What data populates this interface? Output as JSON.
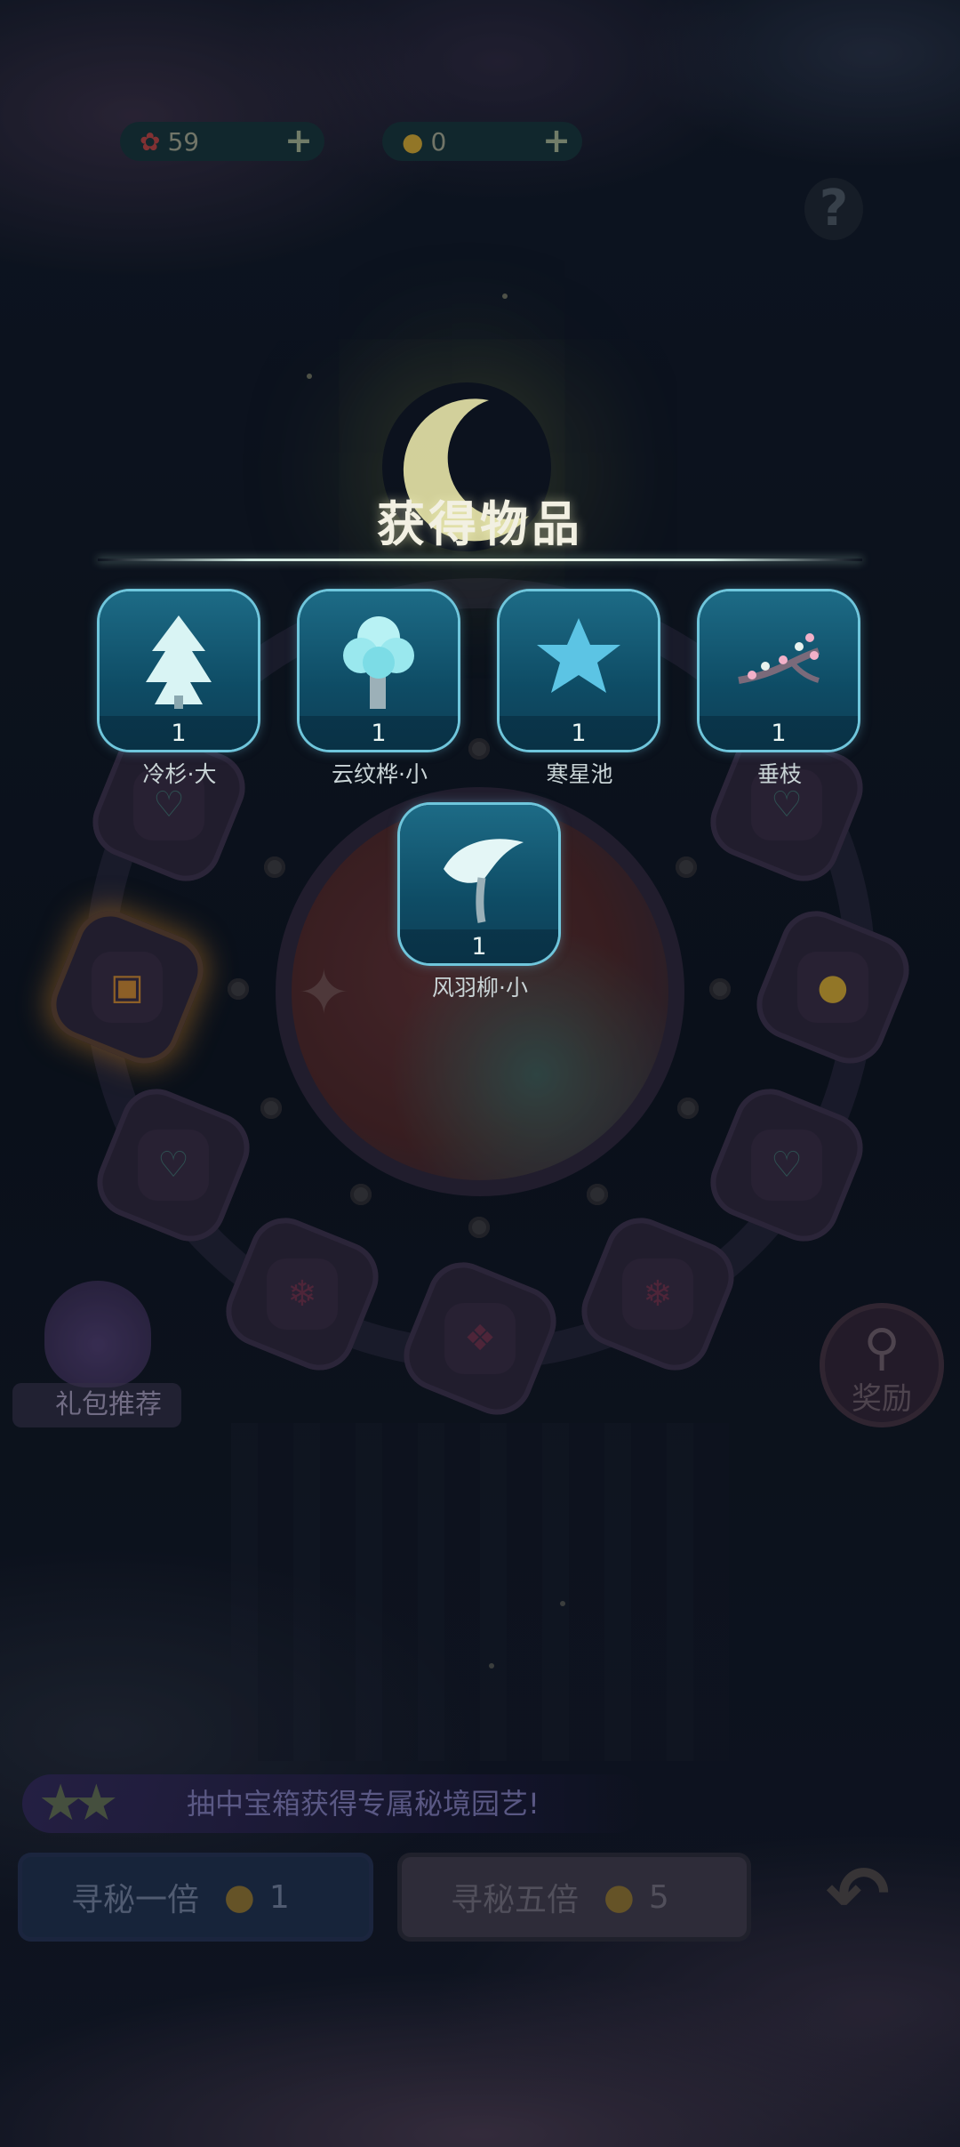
{
  "currency": {
    "gems": {
      "icon": "rose-coin-icon",
      "value": "59"
    },
    "ducks": {
      "icon": "duck-icon",
      "value": "0"
    }
  },
  "help_label": "?",
  "popup": {
    "title": "获得物品",
    "items": [
      {
        "name": "冷杉·大",
        "count": "1",
        "icon": "fir-tree-icon"
      },
      {
        "name": "云纹桦·小",
        "count": "1",
        "icon": "cloud-birch-icon"
      },
      {
        "name": "寒星池",
        "count": "1",
        "icon": "star-pond-icon"
      },
      {
        "name": "垂枝",
        "count": "1",
        "icon": "blossom-branch-icon"
      },
      {
        "name": "风羽柳·小",
        "count": "1",
        "icon": "feather-willow-icon"
      }
    ]
  },
  "gift": {
    "label": "礼包推荐"
  },
  "reward": {
    "label": "奖励"
  },
  "banner": {
    "text": "抽中宝箱获得专属秘境园艺!"
  },
  "buttons": {
    "single": {
      "label": "寻秘一倍",
      "cost": "1"
    },
    "five": {
      "label": "寻秘五倍",
      "cost": "5"
    }
  },
  "colors": {
    "card_border": "#6fc6dc",
    "card_bg": "#0e4c65",
    "title": "#f2f0e2"
  }
}
